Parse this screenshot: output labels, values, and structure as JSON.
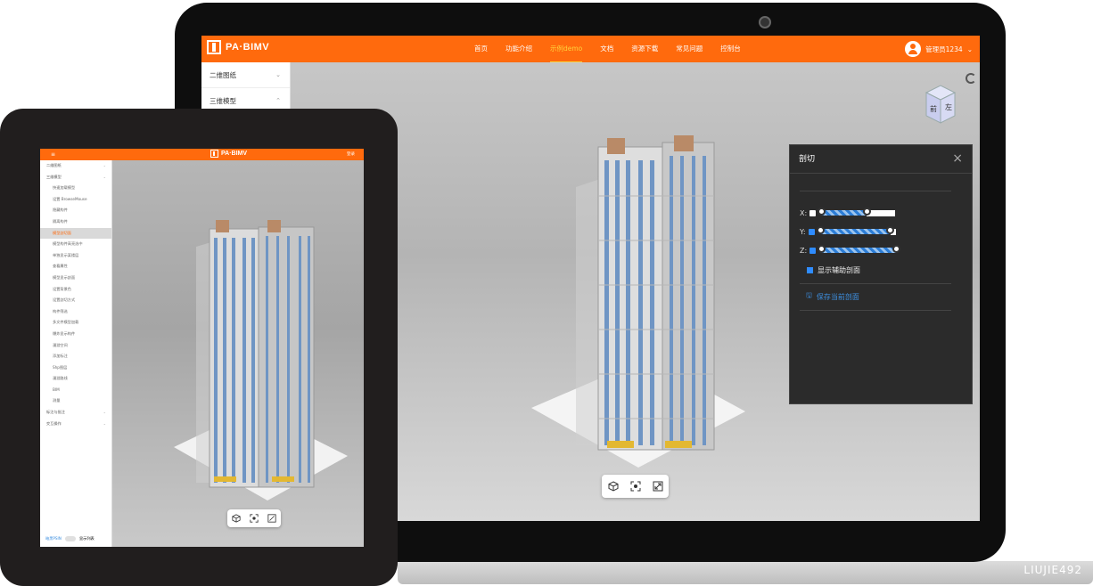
{
  "brand": {
    "logo_text": "PA·BIMV",
    "accent_color": "#ff6a0d"
  },
  "laptop": {
    "nav": [
      "首页",
      "功能介绍",
      "示例demo",
      "文档",
      "资源下载",
      "常见问题",
      "控制台"
    ],
    "active_nav": "示例demo",
    "user_name": "管理员1234",
    "sidebar": [
      {
        "label": "二维图纸",
        "expanded": false
      },
      {
        "label": "三维模型",
        "expanded": true
      }
    ],
    "view_cube": {
      "front": "前",
      "left": "左"
    },
    "section_panel": {
      "title": "剖切",
      "close_label": "×",
      "axes": [
        {
          "label": "X:",
          "checked": false,
          "level": 0.7
        },
        {
          "label": "Y:",
          "checked": true,
          "level": 1.0
        },
        {
          "label": "Z:",
          "checked": true,
          "level": 1.0
        }
      ],
      "show_helper_label": "显示辅助剖面",
      "show_helper_checked": true,
      "save_label": "保存当前剖面"
    },
    "toolbar_icons": [
      "cube-icon",
      "focus-icon",
      "fullscreen-icon"
    ]
  },
  "tablet": {
    "menu_icon": "≡",
    "login": "登录",
    "sidebar": [
      {
        "label": "二维图纸",
        "type": "group"
      },
      {
        "label": "三维模型",
        "type": "group"
      },
      {
        "label": "快速加载模型",
        "type": "sub"
      },
      {
        "label": "设置 BrowseMouse",
        "type": "sub"
      },
      {
        "label": "隐藏构件",
        "type": "sub"
      },
      {
        "label": "隔离构件",
        "type": "sub"
      },
      {
        "label": "模型剖切面",
        "type": "sub",
        "active": true
      },
      {
        "label": "模型构件高亮选中",
        "type": "sub"
      },
      {
        "label": "单独显示某楼层",
        "type": "sub"
      },
      {
        "label": "查看属性",
        "type": "sub"
      },
      {
        "label": "模型显示剖面",
        "type": "sub"
      },
      {
        "label": "设置背景色",
        "type": "sub"
      },
      {
        "label": "设置剖切方式",
        "type": "sub"
      },
      {
        "label": "构件筛选",
        "type": "sub"
      },
      {
        "label": "多文件模型加载",
        "type": "sub"
      },
      {
        "label": "爆炸显示构件",
        "type": "sub"
      },
      {
        "label": "漫游空间",
        "type": "sub"
      },
      {
        "label": "添加标注",
        "type": "sub"
      },
      {
        "label": "Shp图层",
        "type": "sub"
      },
      {
        "label": "漫游路线",
        "type": "sub"
      },
      {
        "label": "BIM",
        "type": "sub"
      },
      {
        "label": "测量",
        "type": "sub"
      },
      {
        "label": "标注与批注",
        "type": "group"
      },
      {
        "label": "交互操作",
        "type": "group"
      }
    ],
    "bottom_left": "暗黑PSIN",
    "bottom_right": "显示列表"
  },
  "watermark": "LIUJIE492"
}
